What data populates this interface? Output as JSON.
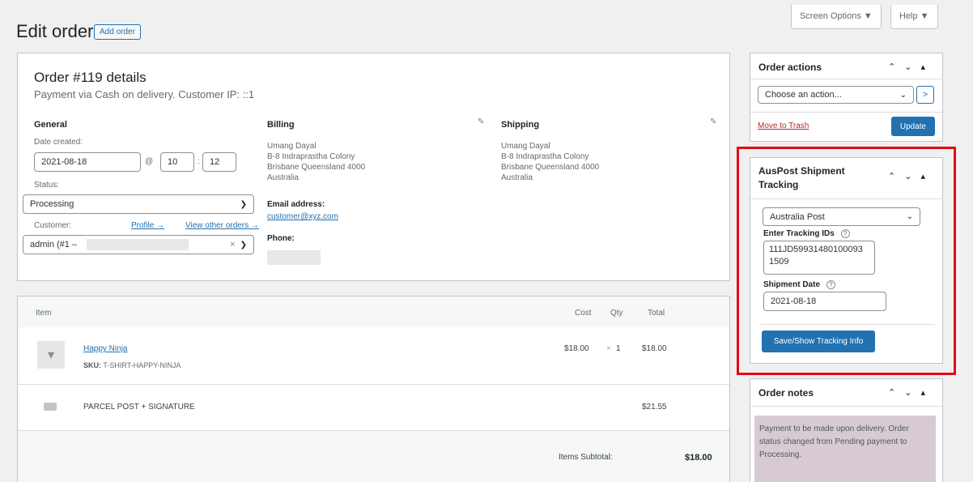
{
  "header": {
    "title": "Edit order",
    "add_order": "Add order",
    "screen_options": "Screen Options ▼",
    "help": "Help ▼"
  },
  "order": {
    "heading": "Order #119 details",
    "subheading": "Payment via Cash on delivery. Customer IP: ::1",
    "general": {
      "title": "General",
      "date_label": "Date created:",
      "date": "2021-08-18",
      "at": "@",
      "hour": "10",
      "colon": ":",
      "minute": "12",
      "status_label": "Status:",
      "status": "Processing",
      "customer_label": "Customer:",
      "profile_link": "Profile →",
      "other_orders_link": "View other orders →",
      "customer": "admin (#1 –",
      "clear": "×"
    },
    "billing": {
      "title": "Billing",
      "name": "Umang Dayal",
      "line1": "B-8 Indraprastha Colony",
      "line2": "Brisbane Queensland 4000",
      "country": "Australia",
      "email_label": "Email address:",
      "email": "customer@xyz.com",
      "phone_label": "Phone:"
    },
    "shipping": {
      "title": "Shipping",
      "name": "Umang Dayal",
      "line1": "B-8 Indraprastha Colony",
      "line2": "Brisbane Queensland 4000",
      "country": "Australia"
    }
  },
  "items": {
    "headers": {
      "item": "Item",
      "cost": "Cost",
      "qty": "Qty",
      "total": "Total"
    },
    "product": {
      "name": "Happy Ninja",
      "sku_label": "SKU:",
      "sku": "T-SHIRT-HAPPY-NINJA",
      "cost": "$18.00",
      "qty_x": "×",
      "qty": "1",
      "total": "$18.00"
    },
    "shipping_line": {
      "name": "PARCEL POST + SIGNATURE",
      "total": "$21.55"
    },
    "subtotal_label": "Items Subtotal:",
    "subtotal": "$18.00"
  },
  "sidebar": {
    "order_actions": {
      "title": "Order actions",
      "select": "Choose an action...",
      "go": ">",
      "trash": "Move to Trash",
      "update": "Update"
    },
    "auspost": {
      "title": "AusPost Shipment Tracking",
      "provider": "Australia Post",
      "tracking_label": "Enter Tracking IDs",
      "tracking_value": "111JD59931480100093 1509",
      "date_label": "Shipment Date",
      "date_value": "2021-08-18",
      "save": "Save/Show Tracking Info",
      "help": "?"
    },
    "notes": {
      "title": "Order notes",
      "note": "Payment to be made upon delivery. Order status changed from Pending payment to Processing."
    },
    "arrows": "⌃ ⌄ ▴"
  },
  "colors": {
    "accent": "#2271b1",
    "highlight": "#e50914",
    "note_bg": "#d7cad2"
  }
}
